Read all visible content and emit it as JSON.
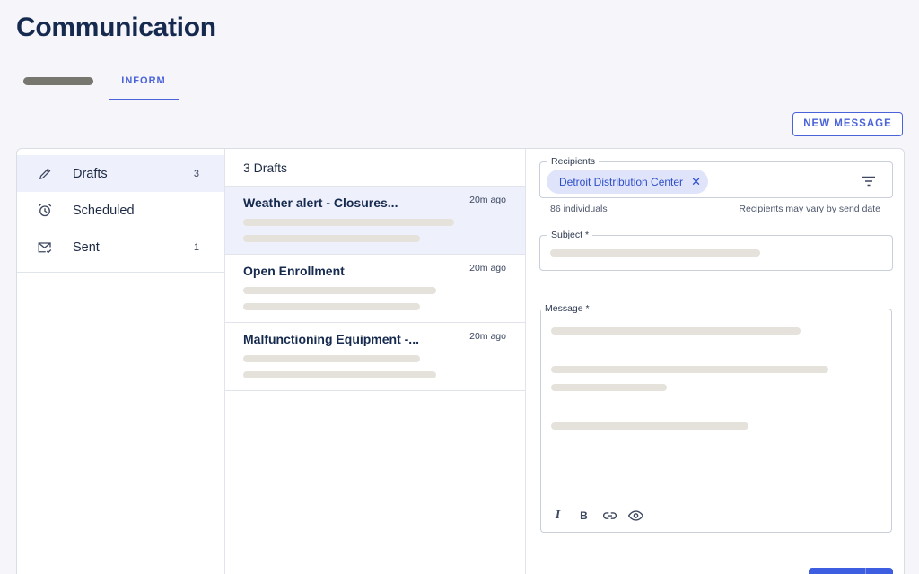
{
  "page": {
    "title": "Communication"
  },
  "tabs": [
    {
      "label": "",
      "placeholder": true
    },
    {
      "label": "INFORM",
      "active": true
    }
  ],
  "toolbar": {
    "new_message_label": "NEW MESSAGE"
  },
  "nav": {
    "items": [
      {
        "label": "Drafts",
        "count": "3",
        "icon": "pencil-icon",
        "active": true
      },
      {
        "label": "Scheduled",
        "count": "",
        "icon": "alarm-clock-icon"
      },
      {
        "label": "Sent",
        "count": "1",
        "icon": "mail-check-icon"
      }
    ]
  },
  "drafts": {
    "header": "3 Drafts",
    "items": [
      {
        "title": "Weather alert - Closures...",
        "time": "20m ago",
        "selected": true
      },
      {
        "title": "Open Enrollment",
        "time": "20m ago"
      },
      {
        "title": "Malfunctioning Equipment -...",
        "time": "20m ago"
      }
    ]
  },
  "compose": {
    "recipients_label": "Recipients",
    "recipient_chip": "Detroit Distribution Center",
    "recipient_count": "86 individuals",
    "recipient_note": "Recipients may vary by send date",
    "subject_label": "Subject *",
    "message_label": "Message *",
    "format_tools": [
      "italic-icon",
      "bold-icon",
      "link-icon",
      "preview-eye-icon"
    ]
  },
  "colors": {
    "accent": "#4a63d9",
    "title": "#152a4e",
    "selected_bg": "#eef0fb"
  }
}
